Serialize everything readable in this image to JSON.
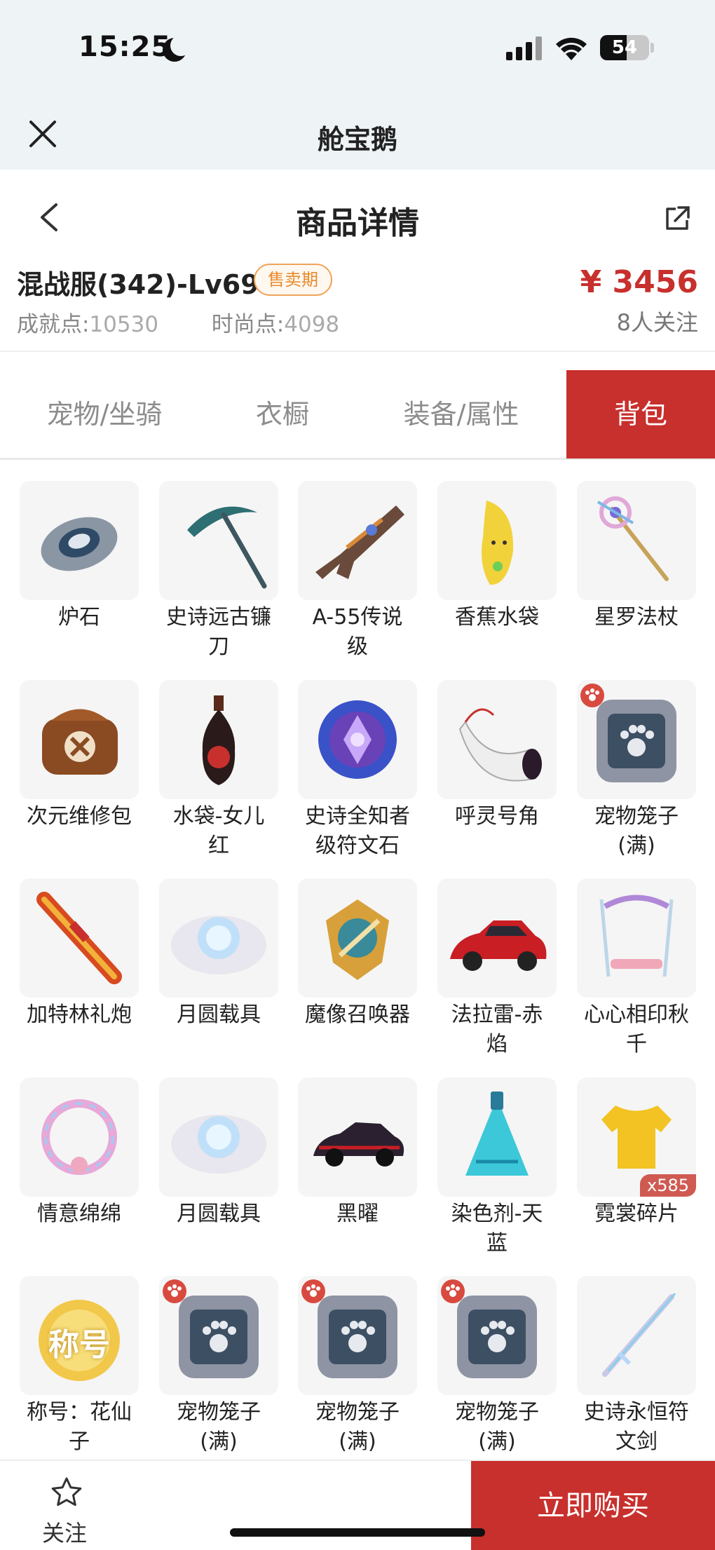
{
  "status": {
    "time": "15:25",
    "battery": "54",
    "battery_level": 0.54
  },
  "wechat": {
    "title": "舱宝鹅"
  },
  "nav": {
    "title": "商品详情"
  },
  "product": {
    "name": "混战服(342)-Lv69",
    "badge": "售卖期",
    "price": "¥ 3456",
    "achievement_label": "成就点:",
    "achievement_value": "10530",
    "fashion_label": "时尚点:",
    "fashion_value": "4098",
    "followers": "8人关注"
  },
  "tabs": [
    {
      "label": "宠物/坐骑"
    },
    {
      "label": "衣橱"
    },
    {
      "label": "装备/属性"
    },
    {
      "label": "背包",
      "active": true
    }
  ],
  "items": [
    {
      "label": "炉石",
      "icon": "stone-icon"
    },
    {
      "label": "史诗远古镰\n刀",
      "icon": "scythe-icon"
    },
    {
      "label": "A-55传说\n级",
      "icon": "gun-icon"
    },
    {
      "label": "香蕉水袋",
      "icon": "banana-icon"
    },
    {
      "label": "星罗法杖",
      "icon": "staff-icon"
    },
    {
      "label": "次元维修包",
      "icon": "repair-bag-icon"
    },
    {
      "label": "水袋-女儿\n红",
      "icon": "gourd-icon"
    },
    {
      "label": "史诗全知者\n级符文石",
      "icon": "rune-stone-icon"
    },
    {
      "label": "呼灵号角",
      "icon": "horn-icon"
    },
    {
      "label": "宠物笼子\n(满)",
      "icon": "pet-cage-icon"
    },
    {
      "label": "加特林礼炮",
      "icon": "cannon-icon"
    },
    {
      "label": "月圆载具",
      "icon": "moon-cloud-icon"
    },
    {
      "label": "魔像召唤器",
      "icon": "summoner-icon"
    },
    {
      "label": "法拉雷-赤\n焰",
      "icon": "red-car-icon"
    },
    {
      "label": "心心相印秋\n千",
      "icon": "swing-icon"
    },
    {
      "label": "情意绵绵",
      "icon": "wreath-icon"
    },
    {
      "label": "月圆载具",
      "icon": "moon-cloud-icon"
    },
    {
      "label": "黑曜",
      "icon": "black-car-icon"
    },
    {
      "label": "染色剂-天\n蓝",
      "icon": "dye-bottle-icon"
    },
    {
      "label": "霓裳碎片",
      "icon": "tshirt-icon",
      "qty": "x585"
    },
    {
      "label": "称号：花仙\n子",
      "icon": "title-badge-icon",
      "badge_text": "称号"
    },
    {
      "label": "宠物笼子\n(满)",
      "icon": "pet-cage-icon"
    },
    {
      "label": "宠物笼子\n(满)",
      "icon": "pet-cage-icon"
    },
    {
      "label": "宠物笼子\n(满)",
      "icon": "pet-cage-icon"
    },
    {
      "label": "史诗永恒符\n文剑",
      "icon": "crystal-sword-icon"
    }
  ],
  "bottom": {
    "follow_label": "关注",
    "buy_label": "立即购买"
  },
  "colors": {
    "accent": "#c8302d",
    "badge": "#e98a2c",
    "background": "#ffffff",
    "status_bg": "#eef3f6"
  }
}
